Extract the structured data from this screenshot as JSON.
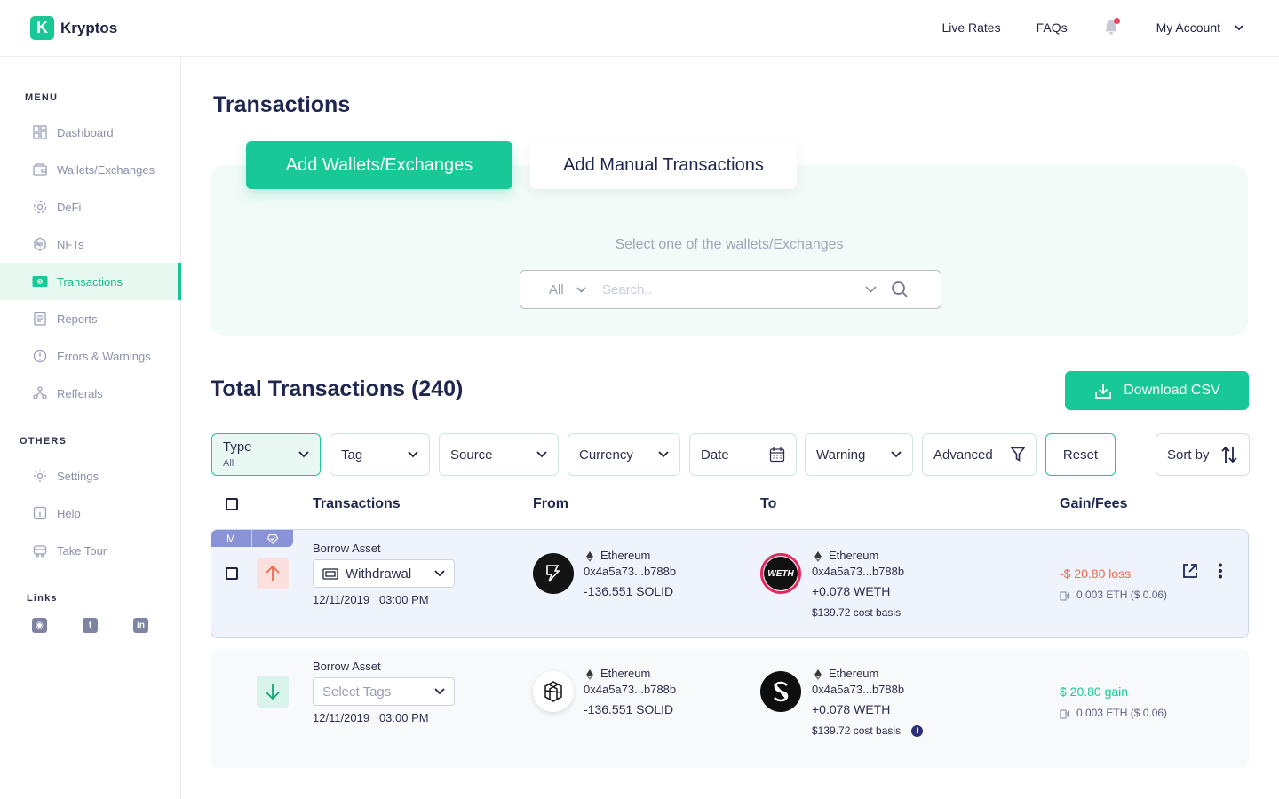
{
  "app": {
    "name": "Kryptos",
    "logo_letter": "K"
  },
  "topnav": {
    "live_rates": "Live Rates",
    "faqs": "FAQs",
    "account": "My Account"
  },
  "sidebar": {
    "menu_title": "MENU",
    "items": [
      {
        "label": "Dashboard",
        "icon": "dashboard-icon"
      },
      {
        "label": "Wallets/Exchanges",
        "icon": "wallet-icon"
      },
      {
        "label": "DeFi",
        "icon": "defi-icon"
      },
      {
        "label": "NFTs",
        "icon": "nft-icon"
      },
      {
        "label": "Transactions",
        "icon": "transactions-icon",
        "active": true
      },
      {
        "label": "Reports",
        "icon": "reports-icon"
      },
      {
        "label": "Errors & Warnings",
        "icon": "warning-icon"
      },
      {
        "label": "Refferals",
        "icon": "referrals-icon"
      }
    ],
    "others_title": "OTHERS",
    "others": [
      {
        "label": "Settings",
        "icon": "gear-icon"
      },
      {
        "label": "Help",
        "icon": "info-icon"
      },
      {
        "label": "Take Tour",
        "icon": "tour-icon"
      }
    ],
    "links_title": "Links",
    "links": [
      "discord-icon",
      "twitter-icon",
      "linkedin-icon"
    ]
  },
  "main": {
    "title": "Transactions",
    "tabs": {
      "active": "Add Wallets/Exchanges",
      "inactive": "Add Manual Transactions"
    },
    "panel_label": "Select one of the wallets/Exchanges",
    "search": {
      "scope": "All",
      "placeholder": "Search.."
    },
    "total_title": "Total Transactions (240)",
    "download_label": "Download CSV"
  },
  "filters": {
    "type": {
      "label": "Type",
      "value": "All"
    },
    "tag": "Tag",
    "source": "Source",
    "currency": "Currency",
    "date": "Date",
    "warning": "Warning",
    "advanced": "Advanced",
    "reset": "Reset",
    "sort": "Sort by"
  },
  "table": {
    "headers": {
      "transactions": "Transactions",
      "from": "From",
      "to": "To",
      "gain": "Gain/Fees"
    },
    "rows": [
      {
        "badge": "M",
        "type": "Borrow Asset",
        "tag": "Withdrawal",
        "date": "12/11/2019",
        "time": "03:00 PM",
        "from_chain": "Ethereum",
        "from_addr": "0x4a5a73...b788b",
        "from_amount": "-136.551 SOLID",
        "to_chain": "Ethereum",
        "to_addr": "0x4a5a73...b788b",
        "to_amount": "+0.078 WETH",
        "cost_basis": "$139.72 cost basis",
        "gain": "-$ 20.80 loss",
        "fee": "0.003 ETH ($ 0.06)",
        "to_avatar_label": "WETH"
      },
      {
        "type": "Borrow Asset",
        "tag_placeholder": "Select Tags",
        "date": "12/11/2019",
        "time": "03:00 PM",
        "from_chain": "Ethereum",
        "from_addr": "0x4a5a73...b788b",
        "from_amount": "-136.551 SOLID",
        "to_chain": "Ethereum",
        "to_addr": "0x4a5a73...b788b",
        "to_amount": "+0.078 WETH",
        "cost_basis": "$139.72 cost basis",
        "gain": "$ 20.80 gain",
        "fee": "0.003 ETH ($ 0.06)"
      }
    ]
  },
  "colors": {
    "brand": "#18c997",
    "loss": "#ef6a4f",
    "text": "#1f2650"
  }
}
